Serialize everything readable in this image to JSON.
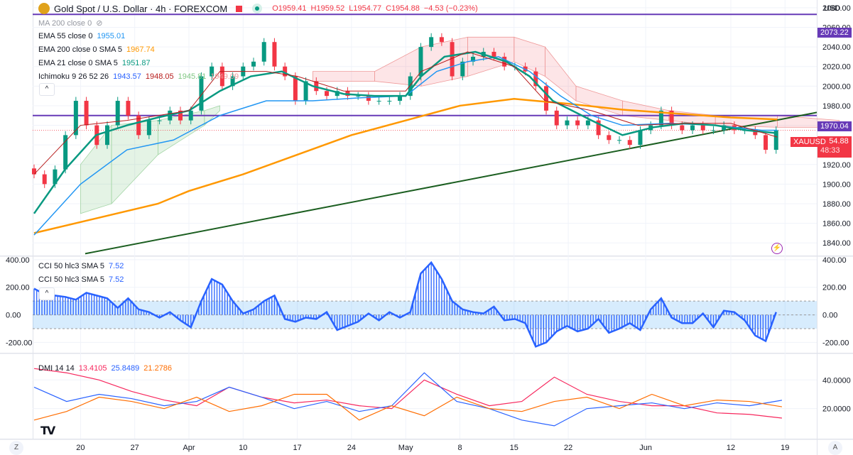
{
  "header": {
    "title": "Gold Spot / U.S. Dollar · 4h · FOREXCOM",
    "open": "O1959.41",
    "high": "H1959.52",
    "low": "L1954.77",
    "close": "C1954.88",
    "change": "−4.53 (−0.23%)",
    "currency": "USD"
  },
  "legend": {
    "ma200": "MA 200 close 0",
    "ema55": {
      "label": "EMA 55 close 0",
      "value": "1955.01"
    },
    "ema200": {
      "label": "EMA 200 close 0 SMA 5",
      "value": "1967.74"
    },
    "ema21": {
      "label": "EMA 21 close 0 SMA 5",
      "value": "1951.87"
    },
    "ichimoku": {
      "label": "Ichimoku 9 26 52 26",
      "v1": "1943.57",
      "v2": "1948.05",
      "v3": "1945.81",
      "v4": "1949.09"
    },
    "cci1": {
      "label": "CCI 50 hlc3 SMA 5",
      "value": "7.52"
    },
    "cci2": {
      "label": "CCI 50 hlc3 SMA 5",
      "value": "7.52"
    },
    "dmi": {
      "label": "DMI 14 14",
      "adx": "13.4105",
      "plus": "25.8489",
      "minus": "21.2786"
    }
  },
  "tags": {
    "symbol": "XAUUSD",
    "last": "1954.88",
    "countdown": "48:33",
    "line1": "2073.22",
    "line2": "1970.04"
  },
  "buttons": {
    "collapse": "^",
    "z": "Z",
    "a": "A"
  },
  "colors": {
    "up": "#089981",
    "down": "#f23645",
    "ema55": "#2196f3",
    "ema200": "#ff9800",
    "ema21": "#089981",
    "kijun": "#b71c1c",
    "hline": "#673ab7",
    "trend": "#1b5e20",
    "cci": "#2962ff",
    "adx": "#f7275d",
    "plus": "#2962ff",
    "minus": "#ff6d00"
  },
  "chart_data": [
    {
      "type": "line",
      "pane": "price",
      "title": "Gold Spot / U.S. Dollar · 4h",
      "xunit": "days from Mar 14",
      "ylim": [
        1830,
        2085
      ],
      "yticks": [
        "2080.00",
        "2060.00",
        "2040.00",
        "2020.00",
        "2000.00",
        "1980.00",
        "1960.00",
        "1940.00",
        "1920.00",
        "1900.00",
        "1880.00",
        "1860.00",
        "1840.00"
      ],
      "xticks": [
        {
          "label": "20",
          "d": 6
        },
        {
          "label": "27",
          "d": 13
        },
        {
          "label": "Apr",
          "d": 20
        },
        {
          "label": "10",
          "d": 27
        },
        {
          "label": "17",
          "d": 34
        },
        {
          "label": "24",
          "d": 41
        },
        {
          "label": "May",
          "d": 48
        },
        {
          "label": "8",
          "d": 55
        },
        {
          "label": "15",
          "d": 62
        },
        {
          "label": "22",
          "d": 69
        },
        {
          "label": "Jun",
          "d": 79
        },
        {
          "label": "12",
          "d": 90
        },
        {
          "label": "19",
          "d": 97
        }
      ],
      "candles": {
        "start_day": 0,
        "step_days": 1.35,
        "close": [
          1910,
          1900,
          1915,
          1950,
          1985,
          1960,
          1940,
          1960,
          1985,
          1970,
          1950,
          1965,
          1965,
          1975,
          1965,
          1975,
          2010,
          2020,
          2000,
          2010,
          2020,
          2025,
          2045,
          2020,
          2010,
          1985,
          2005,
          1995,
          1990,
          1995,
          1990,
          1990,
          1985,
          1985,
          1985,
          1990,
          2010,
          2040,
          2050,
          2045,
          2010,
          2025,
          2030,
          2035,
          2030,
          2020,
          2020,
          2015,
          2000,
          1975,
          1960,
          1965,
          1960,
          1965,
          1950,
          1945,
          1945,
          1940,
          1955,
          1960,
          1975,
          1960,
          1955,
          1960,
          1955,
          1955,
          1960,
          1955,
          1955,
          1950,
          1935,
          1955
        ]
      },
      "series": [
        {
          "name": "EMA 200",
          "points": [
            [
              0,
              1850
            ],
            [
              8,
              1865
            ],
            [
              16,
              1880
            ],
            [
              20,
              1893
            ],
            [
              27,
              1910
            ],
            [
              34,
              1930
            ],
            [
              41,
              1950
            ],
            [
              48,
              1965
            ],
            [
              55,
              1980
            ],
            [
              62,
              1987
            ],
            [
              69,
              1982
            ],
            [
              76,
              1976
            ],
            [
              83,
              1972
            ],
            [
              90,
              1968
            ],
            [
              96,
              1966
            ]
          ]
        },
        {
          "name": "EMA 55",
          "points": [
            [
              0,
              1848
            ],
            [
              6,
              1900
            ],
            [
              12,
              1935
            ],
            [
              18,
              1945
            ],
            [
              24,
              1970
            ],
            [
              30,
              1985
            ],
            [
              36,
              1985
            ],
            [
              42,
              1988
            ],
            [
              48,
              1990
            ],
            [
              52,
              2015
            ],
            [
              56,
              2025
            ],
            [
              60,
              2030
            ],
            [
              64,
              2015
            ],
            [
              68,
              1990
            ],
            [
              72,
              1970
            ],
            [
              76,
              1960
            ],
            [
              82,
              1962
            ],
            [
              88,
              1960
            ],
            [
              94,
              1955
            ],
            [
              96,
              1955
            ]
          ]
        },
        {
          "name": "EMA 21",
          "points": [
            [
              0,
              1870
            ],
            [
              4,
              1915
            ],
            [
              8,
              1950
            ],
            [
              12,
              1960
            ],
            [
              16,
              1968
            ],
            [
              20,
              1975
            ],
            [
              24,
              1995
            ],
            [
              28,
              2010
            ],
            [
              32,
              2015
            ],
            [
              36,
              2000
            ],
            [
              40,
              1992
            ],
            [
              44,
              1990
            ],
            [
              48,
              1990
            ],
            [
              50,
              2010
            ],
            [
              53,
              2030
            ],
            [
              57,
              2035
            ],
            [
              61,
              2025
            ],
            [
              64,
              2010
            ],
            [
              67,
              1985
            ],
            [
              72,
              1965
            ],
            [
              76,
              1950
            ],
            [
              80,
              1958
            ],
            [
              84,
              1962
            ],
            [
              88,
              1960
            ],
            [
              92,
              1955
            ],
            [
              96,
              1952
            ]
          ]
        },
        {
          "name": "Kijun",
          "points": [
            [
              0,
              1910
            ],
            [
              6,
              1960
            ],
            [
              12,
              1965
            ],
            [
              20,
              1975
            ],
            [
              24,
              2015
            ],
            [
              30,
              2015
            ],
            [
              34,
              2010
            ],
            [
              40,
              1995
            ],
            [
              48,
              1995
            ],
            [
              50,
              2015
            ],
            [
              56,
              2035
            ],
            [
              62,
              2020
            ],
            [
              66,
              1985
            ],
            [
              72,
              1975
            ],
            [
              78,
              1960
            ],
            [
              84,
              1962
            ],
            [
              90,
              1962
            ],
            [
              96,
              1948
            ]
          ]
        }
      ],
      "cloud": [
        [
          6,
          1920,
          1870
        ],
        [
          10,
          1960,
          1880
        ],
        [
          16,
          1965,
          1930
        ],
        [
          22,
          1975,
          1960
        ],
        [
          24,
          1980,
          1975
        ],
        [
          36,
          2005,
          2015
        ],
        [
          44,
          2005,
          2015
        ],
        [
          50,
          2000,
          2040
        ],
        [
          56,
          2010,
          2050
        ],
        [
          62,
          2025,
          2050
        ],
        [
          66,
          2010,
          2040
        ],
        [
          70,
          1985,
          2000
        ],
        [
          76,
          1970,
          1985
        ],
        [
          82,
          1965,
          1975
        ],
        [
          88,
          1960,
          1970
        ],
        [
          96,
          1958,
          1970
        ],
        [
          104,
          1958,
          1965
        ]
      ],
      "hlines": [
        2073.22,
        1970.04
      ],
      "trendline": [
        [
          6.6,
          1829
        ],
        [
          101,
          1973
        ]
      ],
      "last_price": 1954.88
    },
    {
      "type": "bar",
      "pane": "cci",
      "title": "CCI 50 hlc3 SMA 5",
      "ylim": [
        -270,
        420
      ],
      "yticks": [
        "400.00",
        "200.00",
        "0.00",
        "-200.00"
      ],
      "band": [
        -100,
        100
      ],
      "start_day": 0,
      "step_days": 1.35,
      "values": [
        190,
        150,
        140,
        130,
        110,
        160,
        140,
        120,
        50,
        120,
        40,
        20,
        -20,
        20,
        -40,
        -90,
        100,
        260,
        220,
        100,
        10,
        40,
        100,
        140,
        -30,
        -50,
        -20,
        -30,
        20,
        -110,
        -80,
        -50,
        10,
        -40,
        20,
        -20,
        20,
        300,
        380,
        260,
        100,
        40,
        20,
        10,
        60,
        -40,
        -30,
        -60,
        -230,
        -200,
        -120,
        -80,
        -120,
        -100,
        -30,
        -130,
        -100,
        -60,
        -110,
        40,
        120,
        -20,
        -60,
        -60,
        10,
        -90,
        30,
        20,
        -40,
        -150,
        -190,
        20
      ]
    },
    {
      "type": "line",
      "pane": "dmi",
      "title": "DMI 14 14",
      "ylim": [
        0,
        58
      ],
      "yticks": [
        "40.0000",
        "20.0000"
      ],
      "start_day": 0,
      "step_days": 4.2,
      "series": [
        {
          "name": "ADX",
          "values": [
            48,
            45,
            40,
            32,
            26,
            22,
            35,
            28,
            24,
            26,
            22,
            20,
            40,
            30,
            22,
            25,
            42,
            30,
            25,
            22,
            22,
            17,
            16,
            13.4
          ]
        },
        {
          "name": "+DI",
          "values": [
            35,
            25,
            30,
            27,
            22,
            25,
            35,
            28,
            20,
            25,
            18,
            22,
            45,
            25,
            20,
            12,
            8,
            20,
            22,
            24,
            20,
            24,
            22,
            25.85
          ]
        },
        {
          "name": "-DI",
          "values": [
            12,
            18,
            28,
            25,
            20,
            28,
            18,
            22,
            30,
            30,
            12,
            22,
            15,
            28,
            20,
            18,
            25,
            28,
            20,
            30,
            22,
            26,
            25,
            21.28
          ]
        }
      ]
    }
  ]
}
